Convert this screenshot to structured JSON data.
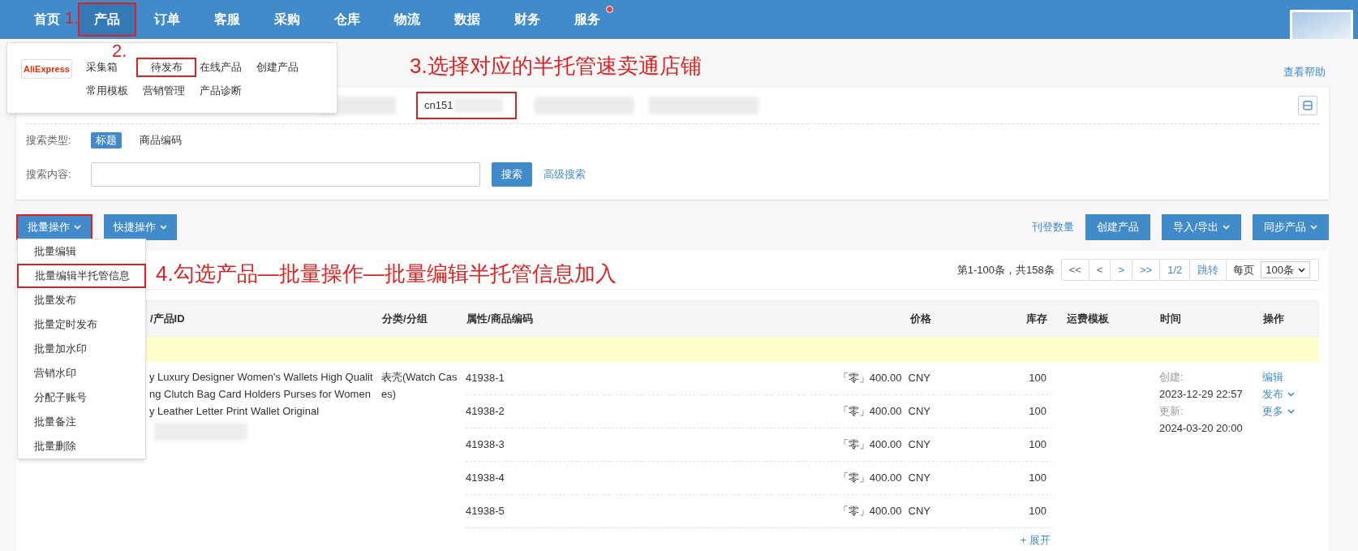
{
  "nav": {
    "items": [
      {
        "label": "首页",
        "selected": false,
        "highlighted": false,
        "dot": false
      },
      {
        "label": "产品",
        "selected": true,
        "highlighted": true,
        "dot": false
      },
      {
        "label": "订单",
        "selected": false,
        "highlighted": false,
        "dot": false
      },
      {
        "label": "客服",
        "selected": false,
        "highlighted": false,
        "dot": false
      },
      {
        "label": "采购",
        "selected": false,
        "highlighted": false,
        "dot": false
      },
      {
        "label": "仓库",
        "selected": false,
        "highlighted": false,
        "dot": false
      },
      {
        "label": "物流",
        "selected": false,
        "highlighted": false,
        "dot": false
      },
      {
        "label": "数据",
        "selected": false,
        "highlighted": false,
        "dot": false
      },
      {
        "label": "财务",
        "selected": false,
        "highlighted": false,
        "dot": false
      },
      {
        "label": "服务",
        "selected": false,
        "highlighted": false,
        "dot": true
      }
    ]
  },
  "product_menu": {
    "logo": "AliExpress",
    "rows": [
      [
        {
          "label": "采集箱",
          "highlighted": false
        },
        {
          "label": "待发布",
          "highlighted": true
        },
        {
          "label": "在线产品",
          "highlighted": false
        },
        {
          "label": "创建产品",
          "highlighted": false
        }
      ],
      [
        {
          "label": "常用模板",
          "highlighted": false
        },
        {
          "label": "营销管理",
          "highlighted": false
        },
        {
          "label": "产品诊断",
          "highlighted": false
        }
      ]
    ]
  },
  "annotations": [
    {
      "text": "1."
    },
    {
      "text": "2."
    },
    {
      "text": "3.选择对应的半托管速卖通店铺"
    },
    {
      "text": "4.勾选产品—批量操作—批量编辑半托管信息加入"
    }
  ],
  "help_link": "查看帮助",
  "shops": [
    {
      "kind": "blurred"
    },
    {
      "kind": "store",
      "label": "cn151",
      "highlighted": true
    },
    {
      "kind": "blurred"
    },
    {
      "kind": "blurred"
    }
  ],
  "search": {
    "type_label": "搜索类型:",
    "types": [
      {
        "label": "标题",
        "selected": true
      },
      {
        "label": "商品编码",
        "selected": false
      }
    ],
    "content_label": "搜索内容:",
    "button": "搜索",
    "advanced": "高级搜索"
  },
  "toolbar": {
    "left": [
      {
        "label": "批量操作",
        "highlighted": true
      },
      {
        "label": "快捷操作",
        "highlighted": false
      }
    ],
    "link": "刊登数量",
    "right": [
      {
        "label": "创建产品",
        "caret": false
      },
      {
        "label": "导入/导出",
        "caret": true
      },
      {
        "label": "同步产品",
        "caret": true
      }
    ]
  },
  "bulk_menu": [
    {
      "label": "批量编辑",
      "highlighted": false
    },
    {
      "label": "批量编辑半托管信息",
      "highlighted": true
    },
    {
      "label": "批量发布",
      "highlighted": false
    },
    {
      "label": "批量定时发布",
      "highlighted": false
    },
    {
      "label": "批量加水印",
      "highlighted": false
    },
    {
      "label": "营销水印",
      "highlighted": false
    },
    {
      "label": "分配子账号",
      "highlighted": false
    },
    {
      "label": "批量备注",
      "highlighted": false
    },
    {
      "label": "批量删除",
      "highlighted": false
    }
  ],
  "pagination": {
    "summary": "第1-100条，共158条",
    "buttons": [
      "<<",
      "<",
      ">",
      ">>",
      "1/2",
      "跳转"
    ],
    "per_page_label": "每页",
    "per_page": "100条"
  },
  "table": {
    "columns": [
      "/产品ID",
      "分类/分组",
      "属性/商品编码",
      "价格",
      "库存",
      "运费模板",
      "时间",
      "操作"
    ],
    "product": {
      "title_lines": [
        "y Luxury Designer Women's Wallets High Qualit",
        "ng Clutch Bag Card Holders Purses for Women",
        "y Leather Letter Print Wallet Original"
      ],
      "category": "表壳(Watch Cases)",
      "variants": [
        {
          "code": "41938-1",
          "price": "「零」400.00",
          "currency": "CNY",
          "stock": "100"
        },
        {
          "code": "41938-2",
          "price": "「零」400.00",
          "currency": "CNY",
          "stock": "100"
        },
        {
          "code": "41938-3",
          "price": "「零」400.00",
          "currency": "CNY",
          "stock": "100"
        },
        {
          "code": "41938-4",
          "price": "「零」400.00",
          "currency": "CNY",
          "stock": "100"
        },
        {
          "code": "41938-5",
          "price": "「零」400.00",
          "currency": "CNY",
          "stock": "100"
        }
      ],
      "expand": "+ 展开",
      "created_label": "创建:",
      "created": "2023-12-29 22:57",
      "updated_label": "更新:",
      "updated": "2024-03-20 20:00",
      "actions": [
        {
          "label": "编辑",
          "caret": false
        },
        {
          "label": "发布",
          "caret": true
        },
        {
          "label": "更多",
          "caret": true
        }
      ]
    }
  }
}
